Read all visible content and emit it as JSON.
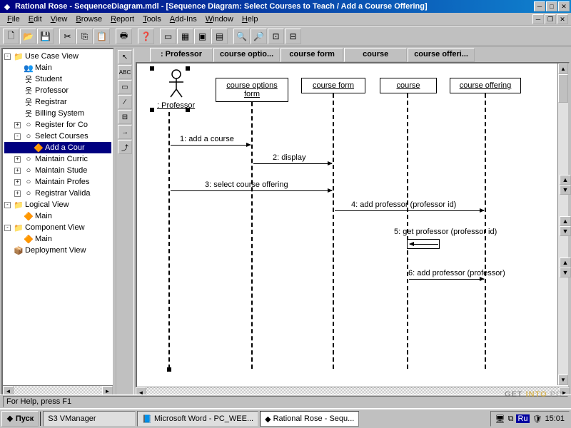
{
  "window": {
    "title": "Rational Rose - SequenceDiagram.mdl - [Sequence Diagram: Select Courses to Teach / Add a Course Offering]"
  },
  "menu": {
    "items": [
      "File",
      "Edit",
      "View",
      "Browse",
      "Report",
      "Tools",
      "Add-Ins",
      "Window",
      "Help"
    ]
  },
  "tree": {
    "items": [
      {
        "level": 0,
        "exp": "-",
        "icon": "📁",
        "label": "Use Case View"
      },
      {
        "level": 1,
        "exp": "",
        "icon": "👥",
        "label": "Main"
      },
      {
        "level": 1,
        "exp": "",
        "icon": "웃",
        "label": "Student"
      },
      {
        "level": 1,
        "exp": "",
        "icon": "웃",
        "label": "Professor"
      },
      {
        "level": 1,
        "exp": "",
        "icon": "웃",
        "label": "Registrar"
      },
      {
        "level": 1,
        "exp": "",
        "icon": "웃",
        "label": "Billing System"
      },
      {
        "level": 1,
        "exp": "+",
        "icon": "○",
        "label": "Register for Co"
      },
      {
        "level": 1,
        "exp": "-",
        "icon": "○",
        "label": "Select Courses"
      },
      {
        "level": 2,
        "exp": "",
        "icon": "🔶",
        "label": "Add a Cour",
        "sel": true
      },
      {
        "level": 1,
        "exp": "+",
        "icon": "○",
        "label": "Maintain Curric"
      },
      {
        "level": 1,
        "exp": "+",
        "icon": "○",
        "label": "Maintain Stude"
      },
      {
        "level": 1,
        "exp": "+",
        "icon": "○",
        "label": "Maintain Profes"
      },
      {
        "level": 1,
        "exp": "+",
        "icon": "○",
        "label": "Registrar Valida"
      },
      {
        "level": 0,
        "exp": "-",
        "icon": "📁",
        "label": "Logical View"
      },
      {
        "level": 1,
        "exp": "",
        "icon": "🔶",
        "label": "Main"
      },
      {
        "level": 0,
        "exp": "-",
        "icon": "📁",
        "label": "Component View"
      },
      {
        "level": 1,
        "exp": "",
        "icon": "🔶",
        "label": "Main"
      },
      {
        "level": 0,
        "exp": "",
        "icon": "📦",
        "label": "Deployment View"
      }
    ]
  },
  "tabs": [
    ": Professor",
    "course optio...",
    "course form",
    "course",
    "course offeri..."
  ],
  "diagram": {
    "actor": {
      "label": ": Professor"
    },
    "objects": [
      "course options form",
      "course form",
      "course",
      "course offering"
    ],
    "messages": [
      "1: add a course",
      "2: display",
      "3: select course offering",
      "4: add professor (professor id)",
      "5: get professor (professor id)",
      "6: add professor (professor)"
    ]
  },
  "status": {
    "help": "For Help, press F1"
  },
  "taskbar": {
    "start": "Пуск",
    "tasks": [
      "S3 VManager",
      "Microsoft Word - PC_WEE...",
      "Rational Rose - Sequ..."
    ],
    "lang": "Ru",
    "time": "15:01"
  },
  "watermark": {
    "w1": "GET ",
    "w2": "INTO ",
    "w3": "PC"
  }
}
